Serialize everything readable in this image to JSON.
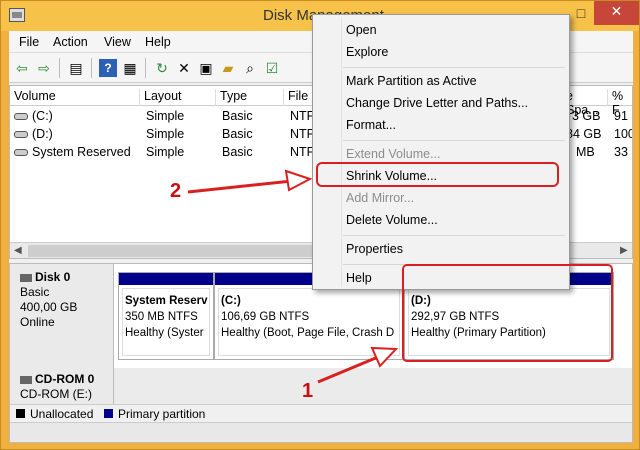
{
  "window": {
    "title": "Disk Management",
    "minimize": "—",
    "maximize": "□",
    "close": "✕"
  },
  "menu": {
    "file": "File",
    "action": "Action",
    "view": "View",
    "help": "Help"
  },
  "toolbar": [
    {
      "icon": "back-arrow-icon",
      "glyph": "⇦"
    },
    {
      "icon": "forward-arrow-icon",
      "glyph": "⇨"
    },
    {
      "icon": "show-hide-console-icon",
      "glyph": "▤"
    },
    {
      "icon": "help-icon",
      "glyph": "?"
    },
    {
      "icon": "show-hide-pane-icon",
      "glyph": "▦"
    },
    {
      "icon": "refresh-icon",
      "glyph": "↻"
    },
    {
      "icon": "delete-icon",
      "glyph": "✕"
    },
    {
      "icon": "properties-icon",
      "glyph": "▣"
    },
    {
      "icon": "open-folder-icon",
      "glyph": "▰"
    },
    {
      "icon": "search-icon",
      "glyph": "⌕"
    },
    {
      "icon": "check-list-icon",
      "glyph": "☑"
    }
  ],
  "volume_list": {
    "headers": {
      "volume": "Volume",
      "layout": "Layout",
      "type": "Type",
      "file": "File",
      "free_space": "e Spa...",
      "pct_free": "% F"
    },
    "rows": [
      {
        "volume": "(C:)",
        "layout": "Simple",
        "type": "Basic",
        "file": "NTF",
        "free": "3 GB",
        "pct": "91"
      },
      {
        "volume": "(D:)",
        "layout": "Simple",
        "type": "Basic",
        "file": "NTF",
        "free": "84 GB",
        "pct": "100"
      },
      {
        "volume": "System Reserved",
        "layout": "Simple",
        "type": "Basic",
        "file": "NTF",
        "free": "MB",
        "pct": "33"
      }
    ]
  },
  "disks": [
    {
      "name": "Disk 0",
      "type": "Basic",
      "size": "400,00 GB",
      "status": "Online",
      "partitions": [
        {
          "name": "System Reserv",
          "size": "350 MB NTFS",
          "status": "Healthy (Syster"
        },
        {
          "name": "(C:)",
          "size": "106,69 GB NTFS",
          "status": "Healthy (Boot, Page File, Crash D"
        },
        {
          "name": "(D:)",
          "size": "292,97 GB NTFS",
          "status": "Healthy (Primary Partition)"
        }
      ]
    },
    {
      "name": "CD-ROM 0",
      "type": "CD-ROM (E:)"
    }
  ],
  "legend": {
    "unallocated": "Unallocated",
    "primary": "Primary partition",
    "unallocated_color": "#000000",
    "primary_color": "#00008b"
  },
  "context_menu": {
    "open": "Open",
    "explore": "Explore",
    "mark_active": "Mark Partition as Active",
    "change_letter": "Change Drive Letter and Paths...",
    "format": "Format...",
    "extend": "Extend Volume...",
    "shrink": "Shrink Volume...",
    "add_mirror": "Add Mirror...",
    "delete": "Delete Volume...",
    "properties": "Properties",
    "help": "Help"
  },
  "annotations": {
    "step1": "1",
    "step2": "2",
    "color": "#d92020"
  }
}
